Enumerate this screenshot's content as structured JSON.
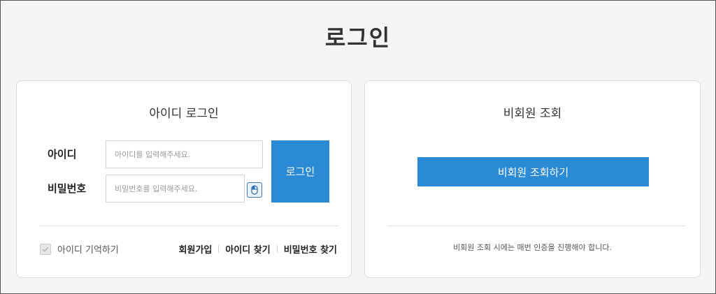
{
  "page": {
    "title": "로그인"
  },
  "login": {
    "title": "아이디 로그인",
    "id_label": "아이디",
    "pw_label": "비밀번호",
    "id_placeholder": "아이디를 입력해주세요.",
    "pw_placeholder": "비밀번호를 입력해주세요.",
    "submit_label": "로그인",
    "remember_label": "아이디 기억하기",
    "links": {
      "signup": "회원가입",
      "find_id": "아이디 찾기",
      "find_pw": "비밀번호 찾기"
    },
    "mouse_icon": "mouse-icon"
  },
  "guest": {
    "title": "비회원 조회",
    "button_label": "비회원 조회하기",
    "notice": "비회원 조회 시에는 매번 인증을 진행해야 합니다."
  },
  "colors": {
    "accent": "#2a8ad4",
    "background": "#f5f5f5"
  }
}
